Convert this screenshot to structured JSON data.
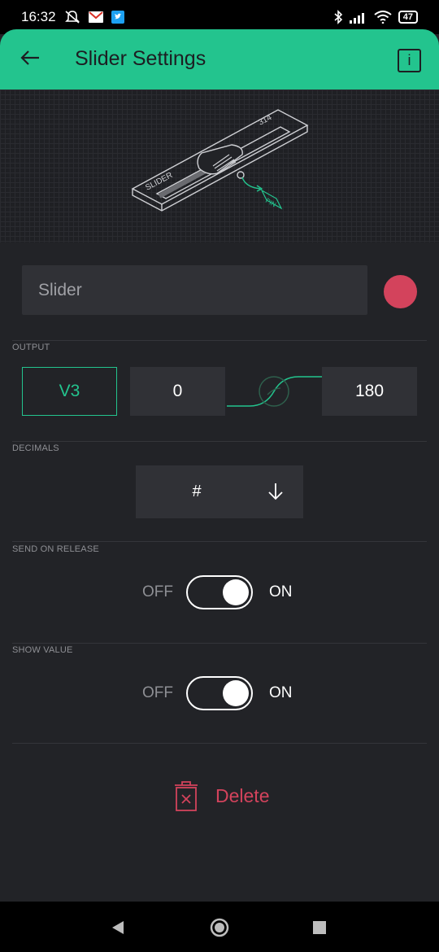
{
  "status_bar": {
    "time": "16:32",
    "battery": "47",
    "icons": [
      "mute-icon",
      "gmail-icon",
      "twitter-icon",
      "bluetooth-icon",
      "signal-icon",
      "wifi-icon",
      "battery-icon"
    ]
  },
  "app_bar": {
    "title": "Slider Settings",
    "info_label": "i",
    "accent_color": "#23c48e"
  },
  "preview": {
    "widget_label": "SLIDER",
    "widget_value": "314",
    "pin_label": "PIN"
  },
  "name_field": {
    "placeholder": "Slider",
    "color": "#d3435c"
  },
  "output": {
    "section_label": "OUTPUT",
    "pin": "V3",
    "min": "0",
    "max": "180"
  },
  "decimals": {
    "section_label": "DECIMALS",
    "value": "#"
  },
  "send_on_release": {
    "section_label": "SEND ON RELEASE",
    "off_label": "OFF",
    "on_label": "ON",
    "state": "on"
  },
  "show_value": {
    "section_label": "SHOW VALUE",
    "off_label": "OFF",
    "on_label": "ON",
    "state": "on"
  },
  "delete": {
    "label": "Delete",
    "color": "#d3435c"
  },
  "nav_bar": {
    "icons": [
      "back-triangle-icon",
      "home-circle-icon",
      "recents-square-icon"
    ]
  }
}
